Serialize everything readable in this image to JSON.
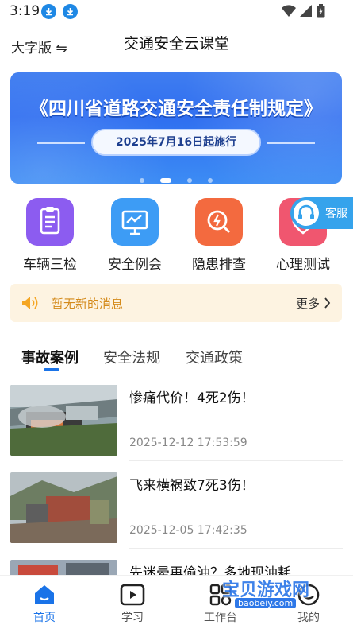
{
  "status_bar": {
    "time": "3:19"
  },
  "header": {
    "font_toggle": "大字版 ⇋",
    "title": "交通安全云课堂"
  },
  "banner": {
    "headline": "《四川省道路交通安全责任制规定》",
    "subline": "2025年7月16日起施行",
    "page_count": 4,
    "active_page": 2
  },
  "quick_actions": [
    {
      "label": "车辆三检",
      "icon": "clipboard-icon",
      "color": "#8c5cf0"
    },
    {
      "label": "安全例会",
      "icon": "presentation-icon",
      "color": "#3d9cf5"
    },
    {
      "label": "隐患排查",
      "icon": "search-alert-icon",
      "color": "#f36a3f"
    },
    {
      "label": "心理测试",
      "icon": "heart-icon",
      "color": "#f0566f"
    }
  ],
  "customer_service": {
    "label": "客服",
    "icon": "headset-icon"
  },
  "notice": {
    "text": "暂无新的消息",
    "more": "更多",
    "icon": "speaker-icon"
  },
  "tabs": [
    {
      "label": "事故案例",
      "active": true
    },
    {
      "label": "安全法规",
      "active": false
    },
    {
      "label": "交通政策",
      "active": false
    }
  ],
  "articles": [
    {
      "title": "惨痛代价！4死2伤！",
      "date": "2025-12-12 17:53:59"
    },
    {
      "title": "飞来横祸致7死3伤！",
      "date": "2025-12-05 17:42:35"
    },
    {
      "title": "先迷晕再偷油？多地现油耗",
      "date": ""
    }
  ],
  "bottom_nav": [
    {
      "label": "首页",
      "icon": "home-icon",
      "active": true
    },
    {
      "label": "学习",
      "icon": "play-icon",
      "active": false
    },
    {
      "label": "工作台",
      "icon": "grid-icon",
      "active": false
    },
    {
      "label": "我的",
      "icon": "user-icon",
      "active": false
    }
  ],
  "watermark": {
    "text": "宝贝游戏网",
    "url": "baobeiy.com"
  },
  "colors": {
    "accent": "#1a73e8",
    "notice_text": "#d48a1a",
    "notice_bg": "#fdf3e1",
    "banner": "#2f6ef0"
  }
}
